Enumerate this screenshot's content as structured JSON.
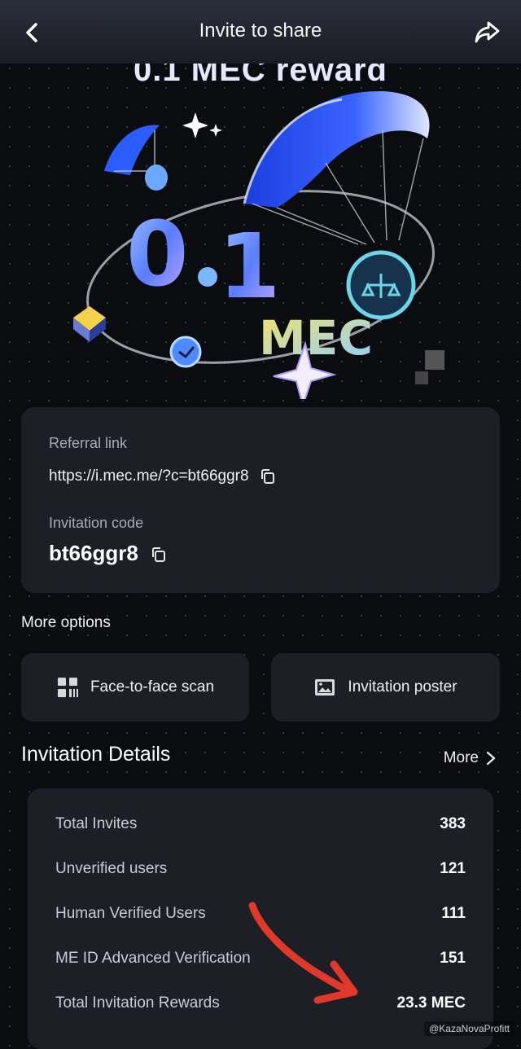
{
  "header": {
    "title": "Invite to share",
    "back_icon": "chevron-left-icon",
    "share_icon": "share-icon"
  },
  "hero": {
    "title": "0.1 MEC reward"
  },
  "referral": {
    "link_label": "Referral link",
    "link_value": "https://i.mec.me/?c=bt66ggr8",
    "code_label": "Invitation code",
    "code_value": "bt66ggr8"
  },
  "more_options": {
    "title": "More options",
    "buttons": [
      {
        "label": "Face-to-face scan",
        "icon": "qr-scan-icon"
      },
      {
        "label": "Invitation poster",
        "icon": "image-poster-icon"
      }
    ]
  },
  "details": {
    "title": "Invitation Details",
    "more_label": "More",
    "rows": [
      {
        "label": "Total Invites",
        "value": "383"
      },
      {
        "label": "Unverified users",
        "value": "121"
      },
      {
        "label": "Human Verified Users",
        "value": "111"
      },
      {
        "label": "ME ID Advanced Verification",
        "value": "151"
      },
      {
        "label": "Total Invitation Rewards",
        "value": "23.3 MEC"
      }
    ]
  },
  "watermark": "@KazaNovaProfitt",
  "colors": {
    "background": "#0b0c10",
    "card": "#1d1f27",
    "accent_blue": "#2b5cff",
    "accent_yellow": "#f4d24a",
    "arrow_red": "#e0382b"
  }
}
